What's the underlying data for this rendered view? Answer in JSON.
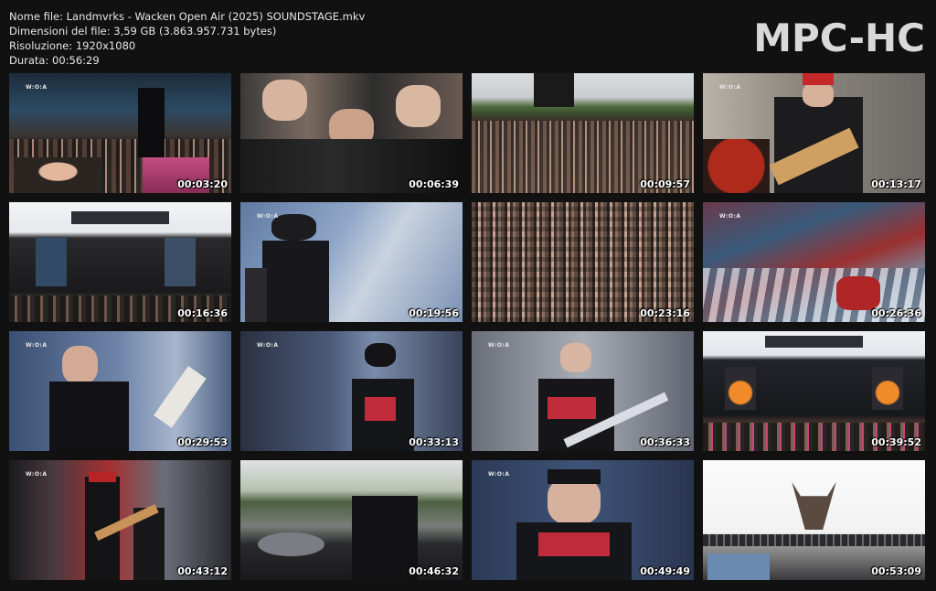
{
  "file_info": {
    "name": "Nome file: Landmvrks - Wacken Open Air (2025) SOUNDSTAGE.mkv",
    "size": "Dimensioni del file: 3,59 GB (3.863.957.731 bytes)",
    "resolution": "Risoluzione: 1920x1080",
    "duration": "Durata: 00:56:29"
  },
  "logo": "MPC-HC",
  "thumbnails": [
    {
      "time": "00:03:20",
      "scene": "stage-crowd"
    },
    {
      "time": "00:06:39",
      "scene": "front-crowd"
    },
    {
      "time": "00:09:57",
      "scene": "festival-crowd"
    },
    {
      "time": "00:13:17",
      "scene": "guitarist"
    },
    {
      "time": "00:16:36",
      "scene": "faster-stage"
    },
    {
      "time": "00:19:56",
      "scene": "singer-blue"
    },
    {
      "time": "00:23:16",
      "scene": "dense-crowd"
    },
    {
      "time": "00:26:36",
      "scene": "backdrop-art"
    },
    {
      "time": "00:29:53",
      "scene": "bassist"
    },
    {
      "time": "00:33:13",
      "scene": "singer-mic"
    },
    {
      "time": "00:36:33",
      "scene": "guitarist-singer"
    },
    {
      "time": "00:39:52",
      "scene": "faster-stage-fire"
    },
    {
      "time": "00:43:12",
      "scene": "band-red"
    },
    {
      "time": "00:46:32",
      "scene": "drummer"
    },
    {
      "time": "00:49:49",
      "scene": "singer-closeup"
    },
    {
      "time": "00:53:09",
      "scene": "bull-skull"
    }
  ],
  "watermark": "W:O:A",
  "colors": {
    "background": "#111111",
    "text": "#e6e6e6",
    "logo": "#d9d9d9"
  }
}
